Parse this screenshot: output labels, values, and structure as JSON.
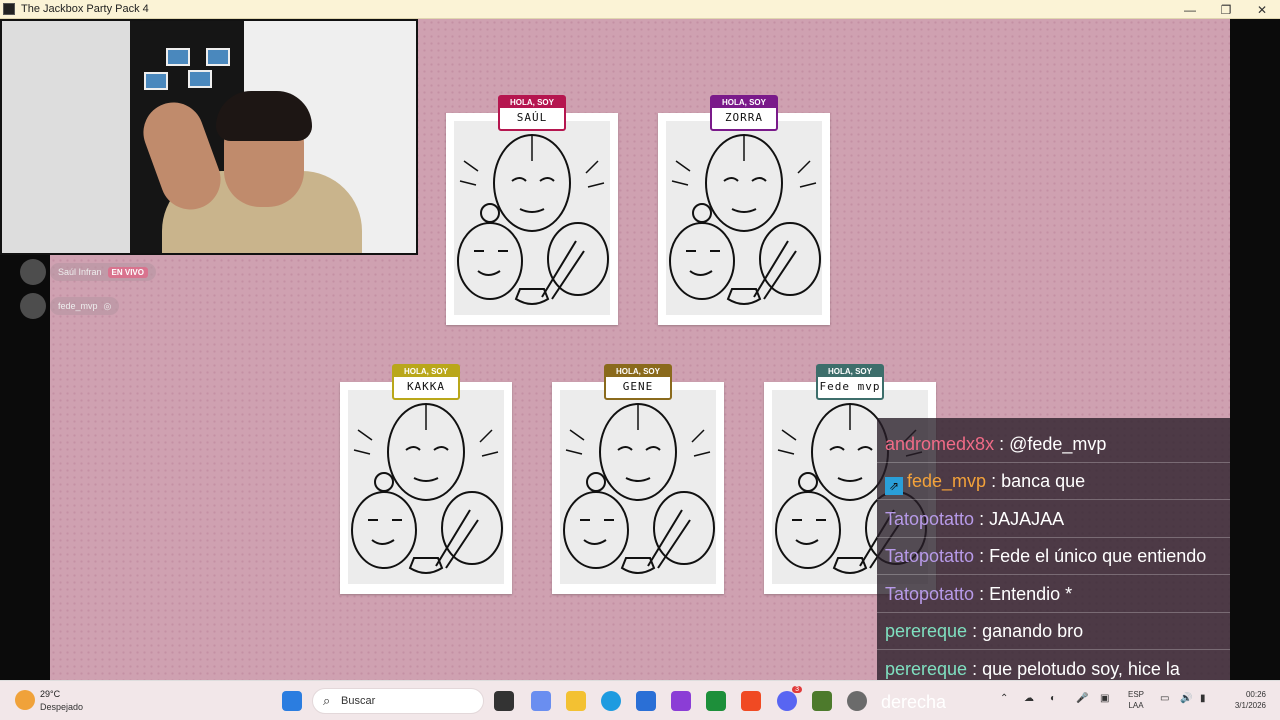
{
  "window": {
    "title": "The Jackbox Party Pack 4",
    "minimize": "—",
    "maximize": "❐",
    "close": "✕"
  },
  "participants": [
    {
      "name": "Saúl Infran",
      "status": "EN VIVO"
    },
    {
      "name": "fede_mvp",
      "status": ""
    }
  ],
  "cards": [
    {
      "tag": "HOLA, SOY",
      "name": "SAÚL",
      "color": "#b5164f"
    },
    {
      "tag": "HOLA, SOY",
      "name": "ZORRA",
      "color": "#7a1a8a"
    },
    {
      "tag": "HOLA, SOY",
      "name": "KAKKA",
      "color": "#b9a71a"
    },
    {
      "tag": "HOLA, SOY",
      "name": "GENE",
      "color": "#8a6a1c"
    },
    {
      "tag": "HOLA, SOY",
      "name": "Fede mvp",
      "color": "#3d6e6b"
    }
  ],
  "chat": [
    {
      "user": "andromedx8x",
      "text": ": @fede_mvp"
    },
    {
      "user": "fede_mvp",
      "text": ": banca que"
    },
    {
      "user": "Tatopotatto",
      "text": ": JAJAJAA"
    },
    {
      "user": "Tatopotatto",
      "text": ": Fede el único que entiendo"
    },
    {
      "user": "Tatopotatto",
      "text": ": Entendio *"
    },
    {
      "user": "perereque",
      "text": ": ganando bro"
    },
    {
      "user": "perereque",
      "text": ": que pelotudo soy, hice la"
    },
    {
      "user": "",
      "text": "derecha"
    }
  ],
  "taskbar": {
    "temperature": "29°C",
    "weather": "Despejado",
    "search_placeholder": "Buscar",
    "language_line1": "ESP",
    "language_line2": "LAA",
    "time": "00:26",
    "date": "3/1/2026",
    "discord_badge": "3"
  },
  "icons": [
    "windows-start-icon",
    "search-icon",
    "task-view-icon",
    "copilot-icon",
    "file-explorer-icon",
    "edge-icon",
    "store-icon",
    "app-icon",
    "xbox-icon",
    "brave-icon",
    "discord-icon",
    "minecraft-icon",
    "settings-icon"
  ]
}
